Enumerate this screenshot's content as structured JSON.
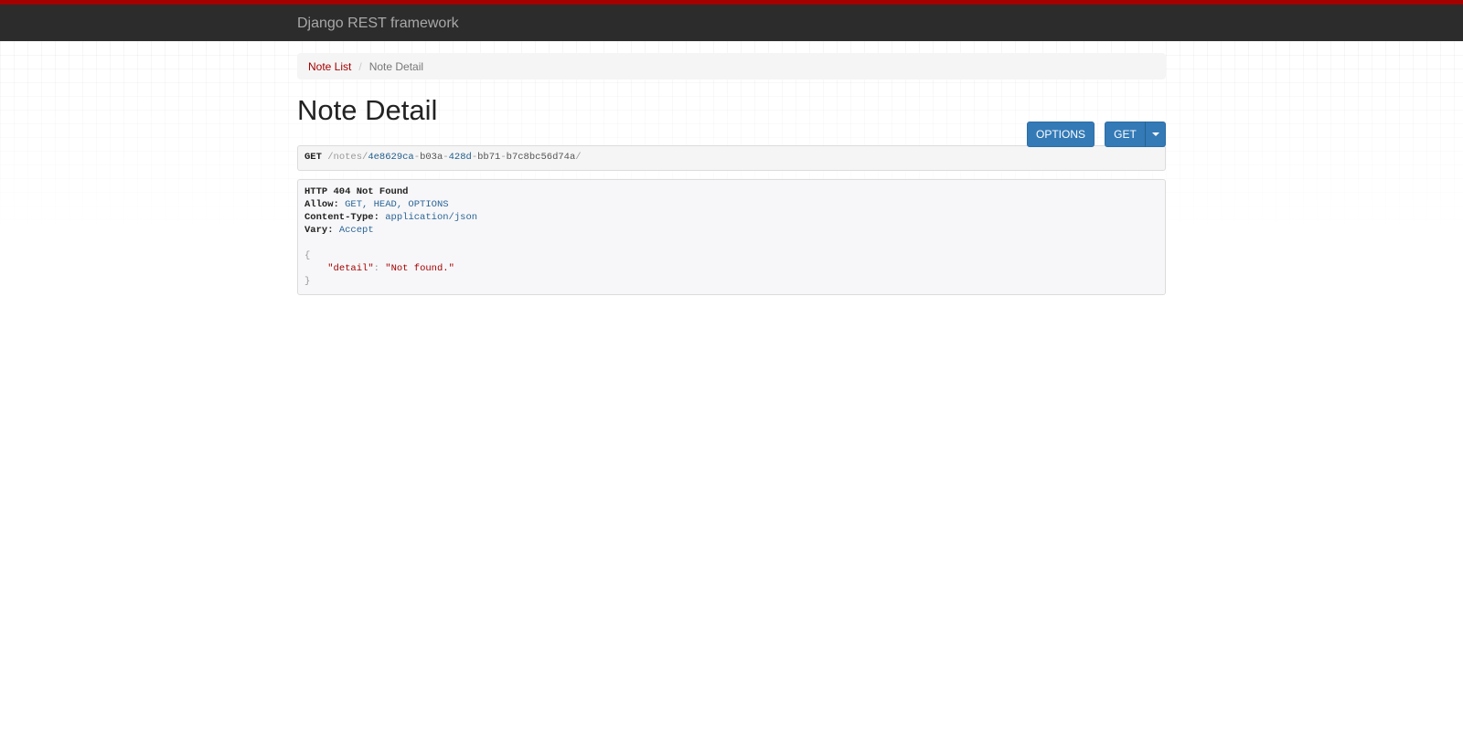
{
  "navbar": {
    "brand": "Django REST framework"
  },
  "breadcrumb": [
    {
      "label": "Note List"
    },
    {
      "label": "Note Detail"
    }
  ],
  "breadcrumb_separator": "/",
  "page_title": "Note Detail",
  "buttons": {
    "options": "OPTIONS",
    "get": "GET"
  },
  "request": {
    "method": "GET",
    "path_prefix": "/notes/",
    "uuid_parts": [
      "4e8629ca",
      "b03a",
      "428d",
      "bb71",
      "b7c8bc56d74a"
    ],
    "dash": "-",
    "path_suffix": "/"
  },
  "response": {
    "status": "HTTP 404 Not Found",
    "headers": [
      {
        "key": "Allow:",
        "value": "GET, HEAD, OPTIONS"
      },
      {
        "key": "Content-Type:",
        "value": "application/json"
      },
      {
        "key": "Vary:",
        "value": "Accept"
      }
    ],
    "body": {
      "open": "{",
      "key": "\"detail\"",
      "colon": ":",
      "value": "\"Not found.\"",
      "close": "}"
    }
  }
}
